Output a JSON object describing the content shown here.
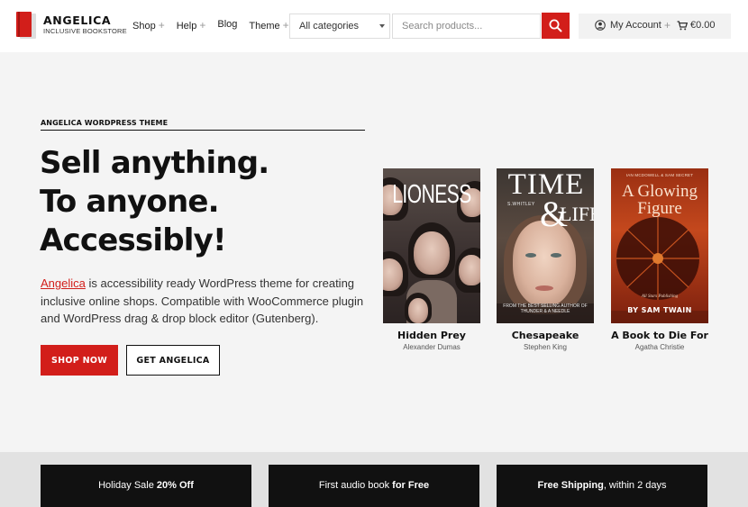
{
  "header": {
    "brand_title": "ANGELICA",
    "brand_subtitle": "INCLUSIVE BOOKSTORE",
    "nav": [
      {
        "label": "Shop",
        "has_submenu": true
      },
      {
        "label": "Help",
        "has_submenu": true
      },
      {
        "label": "Blog",
        "has_submenu": false
      },
      {
        "label": "Theme",
        "has_submenu": true
      }
    ],
    "plus_glyph": "+",
    "category_select": "All categories",
    "search_placeholder": "Search products...",
    "account_label": "My Account",
    "cart_total": "€0.00"
  },
  "hero": {
    "tag": "ANGELICA WORDPRESS THEME",
    "title_lines": [
      "Sell anything.",
      "To anyone.",
      "Accessibly!"
    ],
    "desc_link": "Angelica",
    "desc_rest": " is accessibility ready WordPress theme for creating inclusive online shops. Compatible with WooCommerce plugin and WordPress drag & drop block editor (Gutenberg).",
    "shop_button": "SHOP NOW",
    "get_button": "GET ANGELICA"
  },
  "books": [
    {
      "title": "Hidden Prey",
      "author": "Alexander Dumas",
      "cover_text": "LIONESS"
    },
    {
      "title": "Chesapeake",
      "author": "Stephen King",
      "cover_title": "TIME",
      "cover_and": "&",
      "cover_life": "LIFE",
      "cover_author": "S.WHITLEY",
      "cover_blurb": "FROM THE BEST SELLING AUTHOR OF THUNDER & A NEEDLE"
    },
    {
      "title": "A Book to Die For",
      "author": "Agatha Christie",
      "cover_top": "IAN MCDOWELL & SAM SECRET",
      "cover_title": "A Glowing Figure",
      "cover_pub": "All Stars Publishing",
      "cover_author": "BY SAM TWAIN"
    }
  ],
  "promos": [
    {
      "text": "Holiday Sale ",
      "bold": "20% Off",
      "bold_first": false
    },
    {
      "text": "First audio book ",
      "bold": "for Free",
      "bold_first": false
    },
    {
      "text": ", within 2 days",
      "bold": "Free Shipping",
      "bold_first": true
    }
  ],
  "colors": {
    "accent": "#d21e1a",
    "text": "#111111",
    "background": "#f4f4f4",
    "promo_bg": "#111111"
  },
  "icons": [
    "book-logo-icon",
    "search-icon",
    "user-icon",
    "cart-icon",
    "chevron-down-icon"
  ]
}
